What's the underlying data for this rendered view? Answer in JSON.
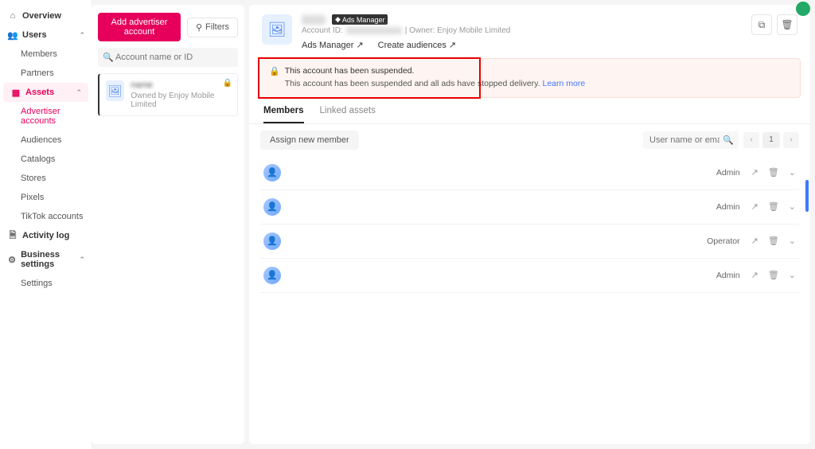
{
  "sidebar": {
    "overview": "Overview",
    "users": "Users",
    "members": "Members",
    "partners": "Partners",
    "assets": "Assets",
    "advertiser_accounts": "Advertiser accounts",
    "audiences": "Audiences",
    "catalogs": "Catalogs",
    "stores": "Stores",
    "pixels": "Pixels",
    "tiktok_accounts": "TikTok accounts",
    "activity_log": "Activity log",
    "business_settings": "Business settings",
    "settings": "Settings"
  },
  "middle": {
    "add_btn": "Add advertiser account",
    "filters_btn": "Filters",
    "search_placeholder": "Account name or ID",
    "card_name": "name",
    "card_owner": "Owned by Enjoy Mobile Limited"
  },
  "header": {
    "ads_manager_badge": "Ads Manager",
    "account_id_label": "Account ID:",
    "owner_label": "| Owner: Enjoy Mobile Limited",
    "link_ads_manager": "Ads Manager",
    "link_create_audiences": "Create audiences"
  },
  "alert": {
    "title": "This account has been suspended.",
    "body": "This account has been suspended and all ads have stopped delivery.",
    "link": "Learn more"
  },
  "tabs": {
    "members": "Members",
    "linked_assets": "Linked assets"
  },
  "toolbar": {
    "assign": "Assign new member",
    "search_placeholder": "User name or email",
    "page": "1"
  },
  "members": [
    {
      "role": "Admin"
    },
    {
      "role": "Admin"
    },
    {
      "role": "Operator"
    },
    {
      "role": "Admin"
    }
  ]
}
